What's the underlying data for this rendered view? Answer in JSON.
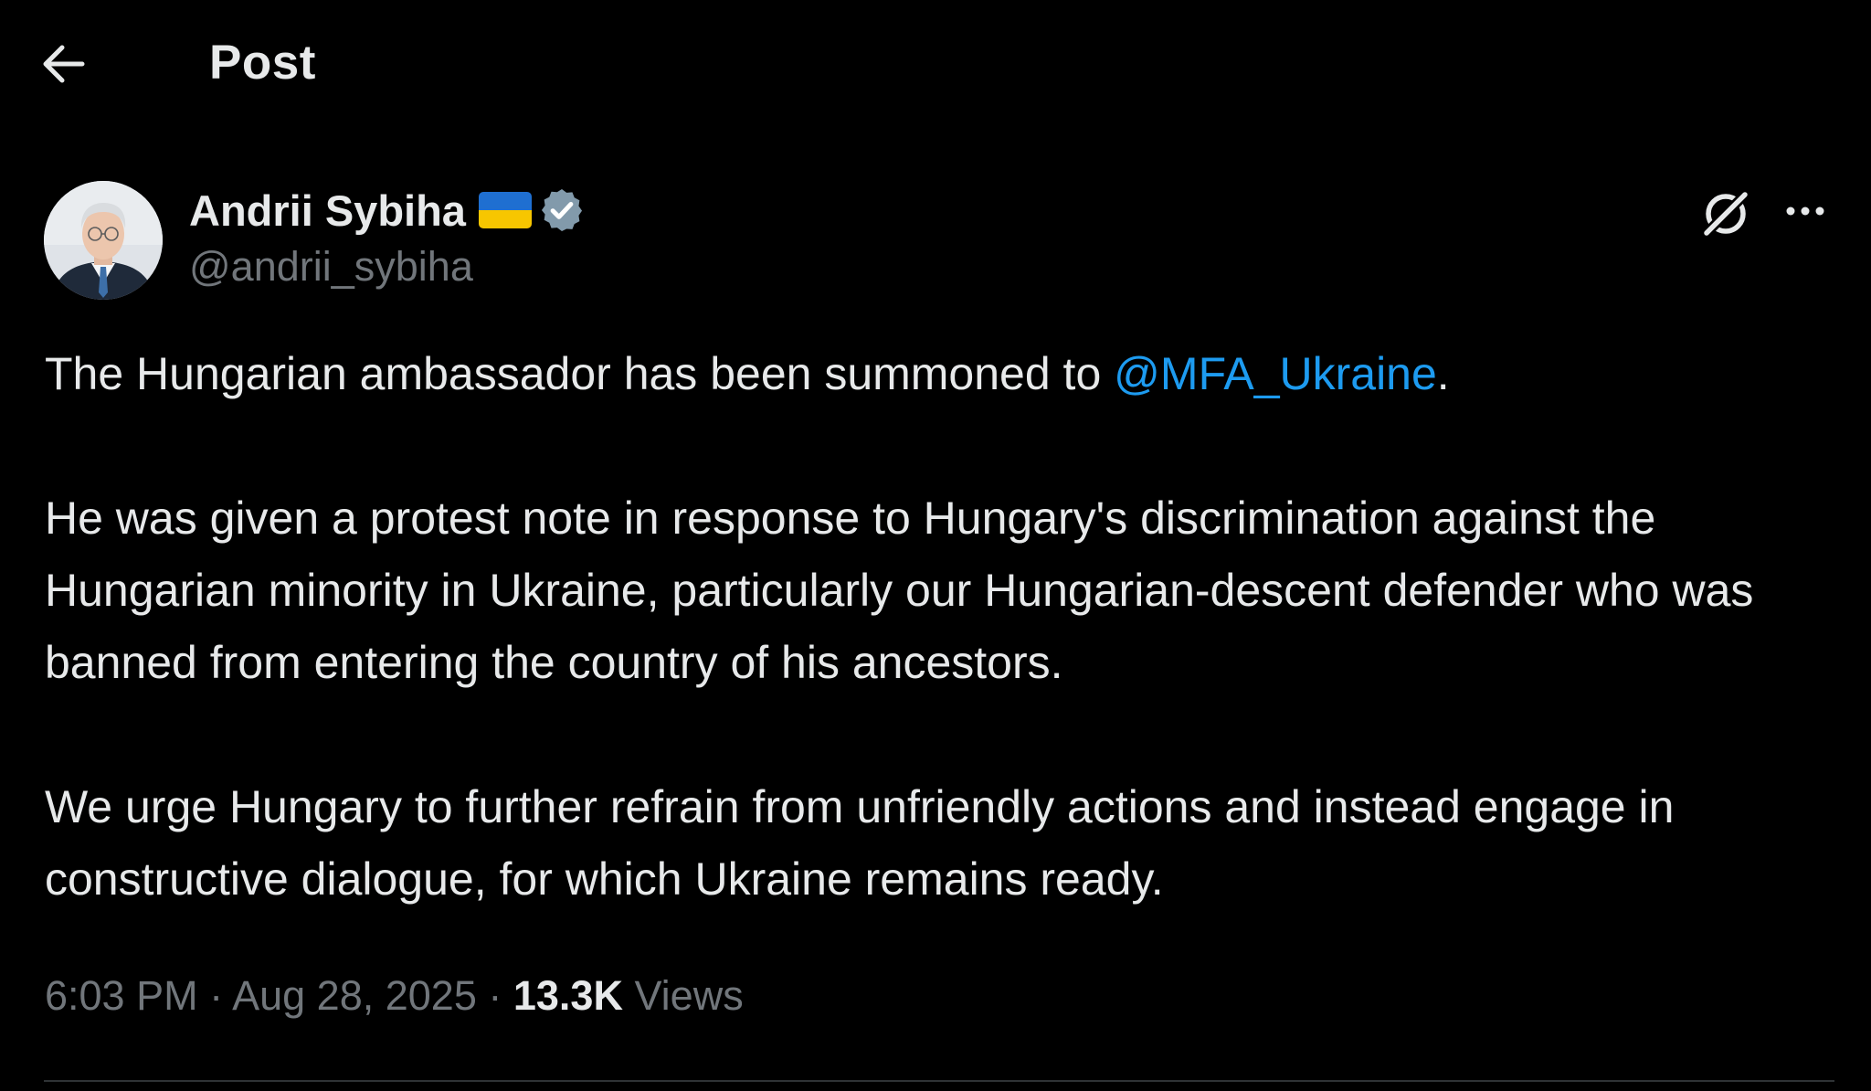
{
  "header": {
    "title": "Post",
    "back_icon": "arrow-left-icon"
  },
  "author": {
    "display_name": "Andrii Sybiha",
    "handle": "@andrii_sybiha",
    "flag": "ukraine-flag",
    "verified": true,
    "verified_color": "#829aab"
  },
  "actions": {
    "grok_icon": "grok-icon",
    "more_icon": "more-horizontal-icon"
  },
  "post": {
    "p1_before": "The Hungarian ambassador has been summoned to ",
    "p1_mention": "@MFA_Ukraine",
    "p1_after": ".",
    "p2": "He was given a protest note in response to Hungary's discrimination against the Hungarian minority in Ukraine, particularly our Hungarian-descent defender who was banned from entering the country of his ancestors.",
    "p3": "We urge Hungary to further refrain from unfriendly actions and instead engage in constructive dialogue, for which Ukraine remains ready."
  },
  "meta": {
    "time": "6:03 PM",
    "separator": " · ",
    "date": "Aug 28, 2025",
    "views_count": "13.3K",
    "views_label": "Views"
  },
  "colors": {
    "background": "#000000",
    "text": "#e7e9ea",
    "secondary": "#71767b",
    "link": "#1d9bf0",
    "divider": "#2f3336"
  }
}
